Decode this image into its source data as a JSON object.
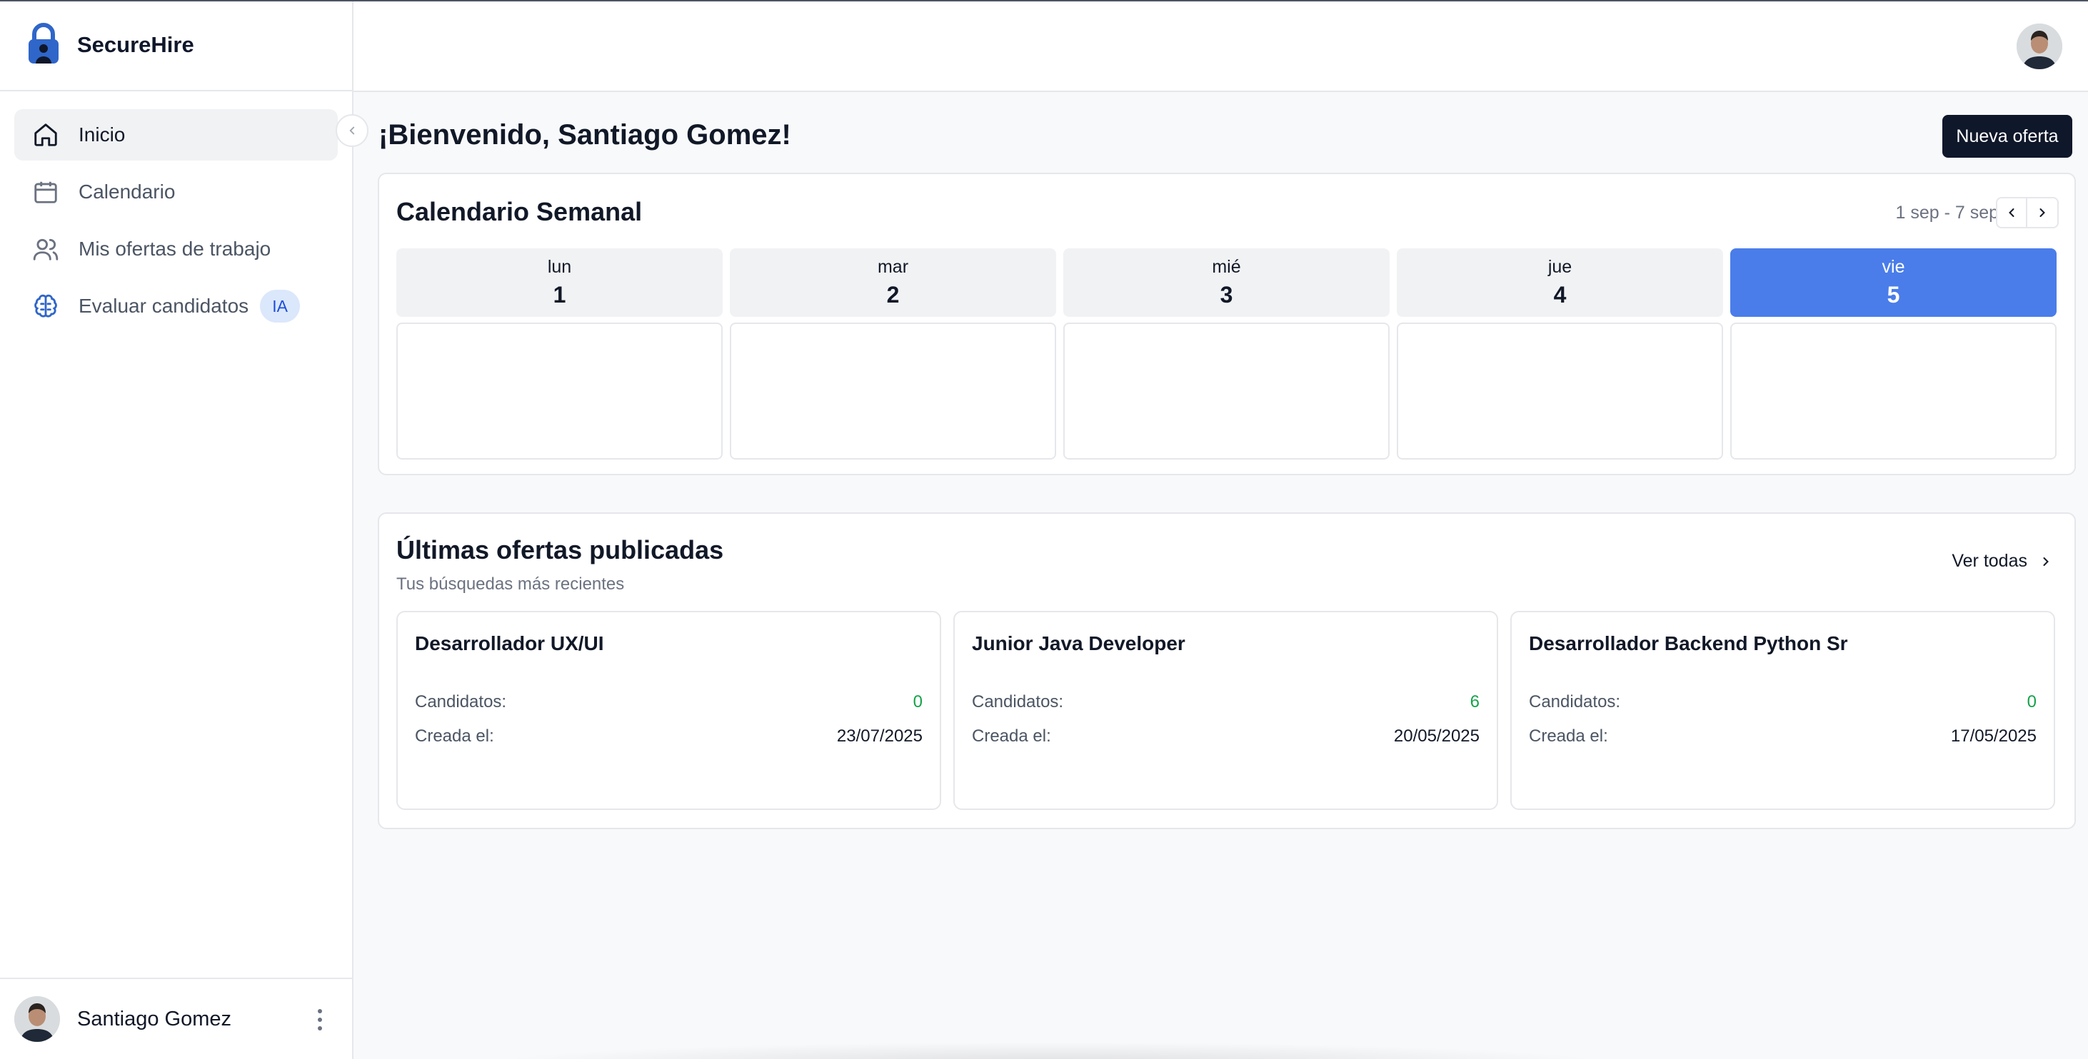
{
  "app": {
    "name": "SecureHire"
  },
  "sidebar": {
    "items": [
      {
        "label": "Inicio",
        "icon": "home-icon",
        "active": true
      },
      {
        "label": "Calendario",
        "icon": "calendar-icon",
        "active": false
      },
      {
        "label": "Mis ofertas de trabajo",
        "icon": "users-icon",
        "active": false
      },
      {
        "label": "Evaluar candidatos",
        "icon": "brain-icon",
        "active": false,
        "badge": "IA"
      }
    ],
    "user": {
      "name": "Santiago Gomez"
    }
  },
  "main": {
    "welcome": "¡Bienvenido, Santiago Gomez!",
    "new_offer_label": "Nueva oferta"
  },
  "calendar": {
    "title": "Calendario Semanal",
    "range": "1 sep - 7 sep",
    "days": [
      {
        "name": "lun",
        "date": "1"
      },
      {
        "name": "mar",
        "date": "2"
      },
      {
        "name": "mié",
        "date": "3"
      },
      {
        "name": "jue",
        "date": "4"
      },
      {
        "name": "vie",
        "date": "5",
        "today": true
      }
    ]
  },
  "jobs": {
    "title": "Últimas ofertas publicadas",
    "subtitle": "Tus búsquedas más recientes",
    "see_all": "Ver todas",
    "candidates_label": "Candidatos:",
    "created_label": "Creada el:",
    "items": [
      {
        "title": "Desarrollador UX/UI",
        "candidates": "0",
        "created": "23/07/2025"
      },
      {
        "title": "Junior Java Developer",
        "candidates": "6",
        "created": "20/05/2025"
      },
      {
        "title": "Desarrollador Backend Python Sr",
        "candidates": "0",
        "created": "17/05/2025"
      }
    ]
  },
  "colors": {
    "accent": "#4a7dea",
    "primary_button": "#0f172a",
    "badge_bg": "#dbe7fb",
    "count_green": "#16a34a"
  }
}
